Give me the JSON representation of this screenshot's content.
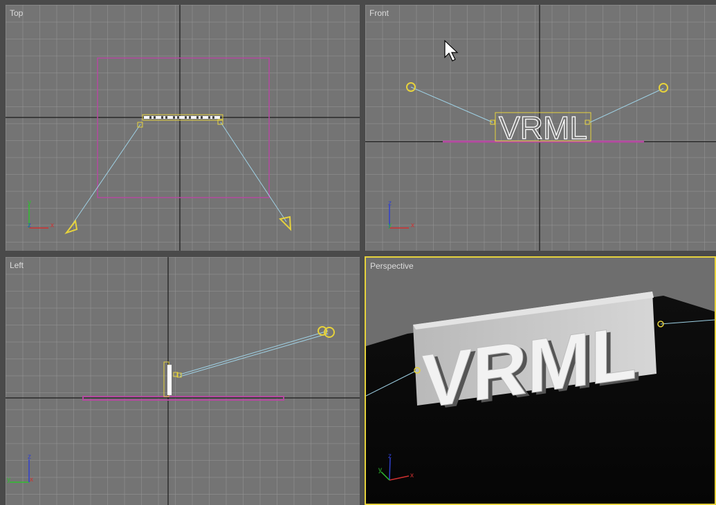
{
  "viewports": {
    "top": {
      "label": "Top",
      "axes": [
        "y",
        "z",
        "x"
      ]
    },
    "front": {
      "label": "Front",
      "axes": [
        "z",
        "y",
        "x"
      ]
    },
    "left": {
      "label": "Left",
      "axes": [
        "z",
        "y",
        "x"
      ]
    },
    "perspective": {
      "label": "Perspective",
      "axes": [
        "z",
        "y",
        "x"
      ],
      "active": true
    }
  },
  "scene": {
    "text_object": "VRML"
  },
  "colors": {
    "grid_bg": "#747474",
    "grid_line": "#969696",
    "selection": "#e6d23c",
    "ground": "#b44aa0",
    "light_link": "#9fd2e6",
    "axis_x": "#d03030",
    "axis_y": "#2fbf2f",
    "axis_z": "#3040d0"
  }
}
